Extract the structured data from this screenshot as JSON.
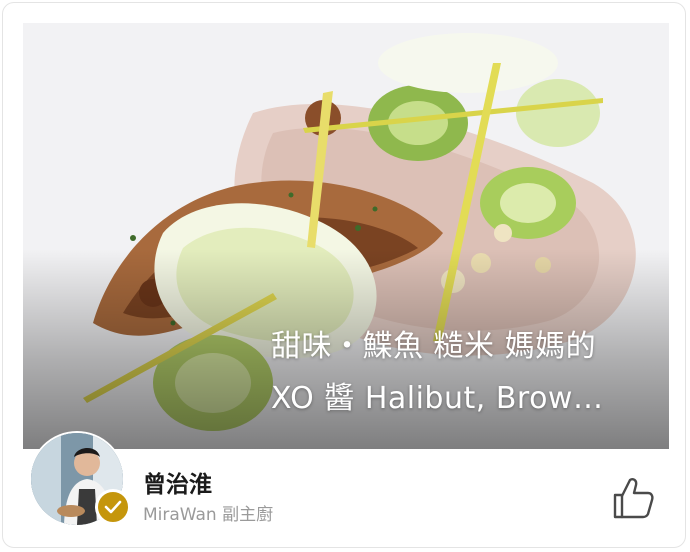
{
  "card": {
    "title_line1": "甜味・鰈魚 糙米 媽媽的",
    "title_line2": "XO 醬 Halibut, Brow…"
  },
  "author": {
    "name": "曾治淮",
    "role": "MiraWan 副主廚",
    "verified": true
  },
  "icons": {
    "like": "thumbs-up-icon",
    "verified": "check-icon"
  },
  "colors": {
    "verified_badge": "#c5960c",
    "title_text": "#ffffff",
    "author_name": "#1b1b1b",
    "author_role": "#9a9a9a"
  }
}
